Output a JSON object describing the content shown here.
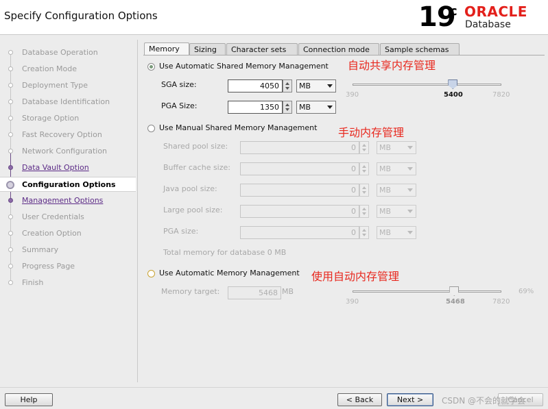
{
  "header": {
    "title": "Specify Configuration Options",
    "version_number": "19",
    "version_suffix": "c",
    "brand": "ORACLE",
    "product": "Database"
  },
  "nav": {
    "items": [
      {
        "label": "Database Operation",
        "state": "disabled"
      },
      {
        "label": "Creation Mode",
        "state": "disabled"
      },
      {
        "label": "Deployment Type",
        "state": "disabled"
      },
      {
        "label": "Database Identification",
        "state": "disabled"
      },
      {
        "label": "Storage Option",
        "state": "disabled"
      },
      {
        "label": "Fast Recovery Option",
        "state": "disabled"
      },
      {
        "label": "Network Configuration",
        "state": "disabled"
      },
      {
        "label": "Data Vault Option",
        "state": "link"
      },
      {
        "label": "Configuration Options",
        "state": "current"
      },
      {
        "label": "Management Options",
        "state": "link"
      },
      {
        "label": "User Credentials",
        "state": "disabled"
      },
      {
        "label": "Creation Option",
        "state": "disabled"
      },
      {
        "label": "Summary",
        "state": "disabled"
      },
      {
        "label": "Progress Page",
        "state": "disabled"
      },
      {
        "label": "Finish",
        "state": "disabled"
      }
    ]
  },
  "tabs": [
    {
      "label": "Memory",
      "active": true
    },
    {
      "label": "Sizing",
      "active": false
    },
    {
      "label": "Character sets",
      "active": false
    },
    {
      "label": "Connection mode",
      "active": false
    },
    {
      "label": "Sample schemas",
      "active": false
    }
  ],
  "asmm": {
    "label": "Use Automatic Shared Memory Management",
    "selected": true,
    "annotation": "自动共享内存管理",
    "sga_label": "SGA size:",
    "sga_value": "4050",
    "sga_unit": "MB",
    "pga_label": "PGA Size:",
    "pga_value": "1350",
    "pga_unit": "MB",
    "slider": {
      "min": "390",
      "value": "5400",
      "max": "7820"
    }
  },
  "manual": {
    "label": "Use Manual Shared Memory Management",
    "selected": false,
    "annotation": "手动内存管理",
    "fields": [
      {
        "label": "Shared pool size:",
        "value": "0",
        "unit": "MB"
      },
      {
        "label": "Buffer cache size:",
        "value": "0",
        "unit": "MB"
      },
      {
        "label": "Java pool size:",
        "value": "0",
        "unit": "MB"
      },
      {
        "label": "Large pool size:",
        "value": "0",
        "unit": "MB"
      },
      {
        "label": "PGA size:",
        "value": "0",
        "unit": "MB"
      }
    ],
    "total_label": "Total memory for database 0 MB"
  },
  "amm": {
    "label": "Use Automatic Memory Management",
    "selected": false,
    "annotation": "使用自动内存管理",
    "target_label": "Memory target:",
    "target_value": "5468",
    "target_unit": "MB",
    "slider": {
      "min": "390",
      "value": "5468",
      "max": "7820",
      "percent": "69%"
    }
  },
  "footer": {
    "help": "Help",
    "back": "< Back",
    "next": "Next >",
    "cancel": "Cancel"
  },
  "watermark": "CSDN @不会的就学会"
}
